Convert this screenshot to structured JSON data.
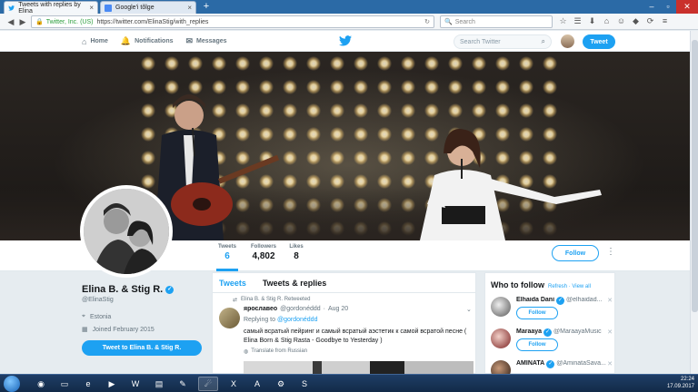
{
  "browser": {
    "tabs": [
      {
        "label": "Tweets with replies by Elina",
        "active": true
      },
      {
        "label": "Google'i tõlge",
        "active": false
      }
    ],
    "new_tab": "+",
    "url_site": "Twitter, Inc. (US)",
    "url_path": "https://twitter.com/ElinaStig/with_replies",
    "search_placeholder": "Search"
  },
  "header": {
    "nav": [
      {
        "label": "Home",
        "icon": "home-icon"
      },
      {
        "label": "Notifications",
        "icon": "bell-icon"
      },
      {
        "label": "Messages",
        "icon": "envelope-icon"
      }
    ],
    "search_placeholder": "Search Twitter",
    "tweet_button": "Tweet"
  },
  "profile": {
    "name": "Elina B. & Stig R.",
    "handle": "@ElinaStig",
    "location": "Estonia",
    "joined": "Joined February 2015",
    "tweet_to_button": "Tweet to Elina B. & Stig R."
  },
  "stats": [
    {
      "label": "Tweets",
      "value": "6",
      "active": true
    },
    {
      "label": "Followers",
      "value": "4,802",
      "active": false
    },
    {
      "label": "Likes",
      "value": "8",
      "active": false
    }
  ],
  "follow_button": "Follow",
  "timeline": {
    "tabs": [
      {
        "label": "Tweets",
        "active": true
      },
      {
        "label": "Tweets & replies",
        "active": false
      }
    ],
    "tweet": {
      "retweet_note": "Elina B. & Stig R. Retweeted",
      "author": "ярославео",
      "handle": "@gordonéddd",
      "time": "Aug 20",
      "replying_prefix": "Replying to",
      "replying_to": "@gordonéddd",
      "text": "самый всратый пейринг и самый всратый аэстетик к самой всратой песне ( Elina Born & Stig Rasta - Goodbye to Yesterday )",
      "translate": "Translate from Russian"
    }
  },
  "who_to_follow": {
    "title": "Who to follow",
    "refresh": "Refresh",
    "view_all": "View all",
    "separator": "·",
    "accounts": [
      {
        "name": "Elhaida Dani",
        "handle": "@elhaidad...",
        "button": "Follow"
      },
      {
        "name": "Maraaya",
        "handle": "@MaraayaMusic",
        "button": "Follow"
      },
      {
        "name": "AMINATA",
        "handle": "@AminataSava...",
        "button": ""
      }
    ]
  },
  "taskbar": {
    "time": "22:24",
    "date": "17.09.2017"
  },
  "colors": {
    "accent": "#1da1f2",
    "page_bg": "#e6ecf0"
  }
}
